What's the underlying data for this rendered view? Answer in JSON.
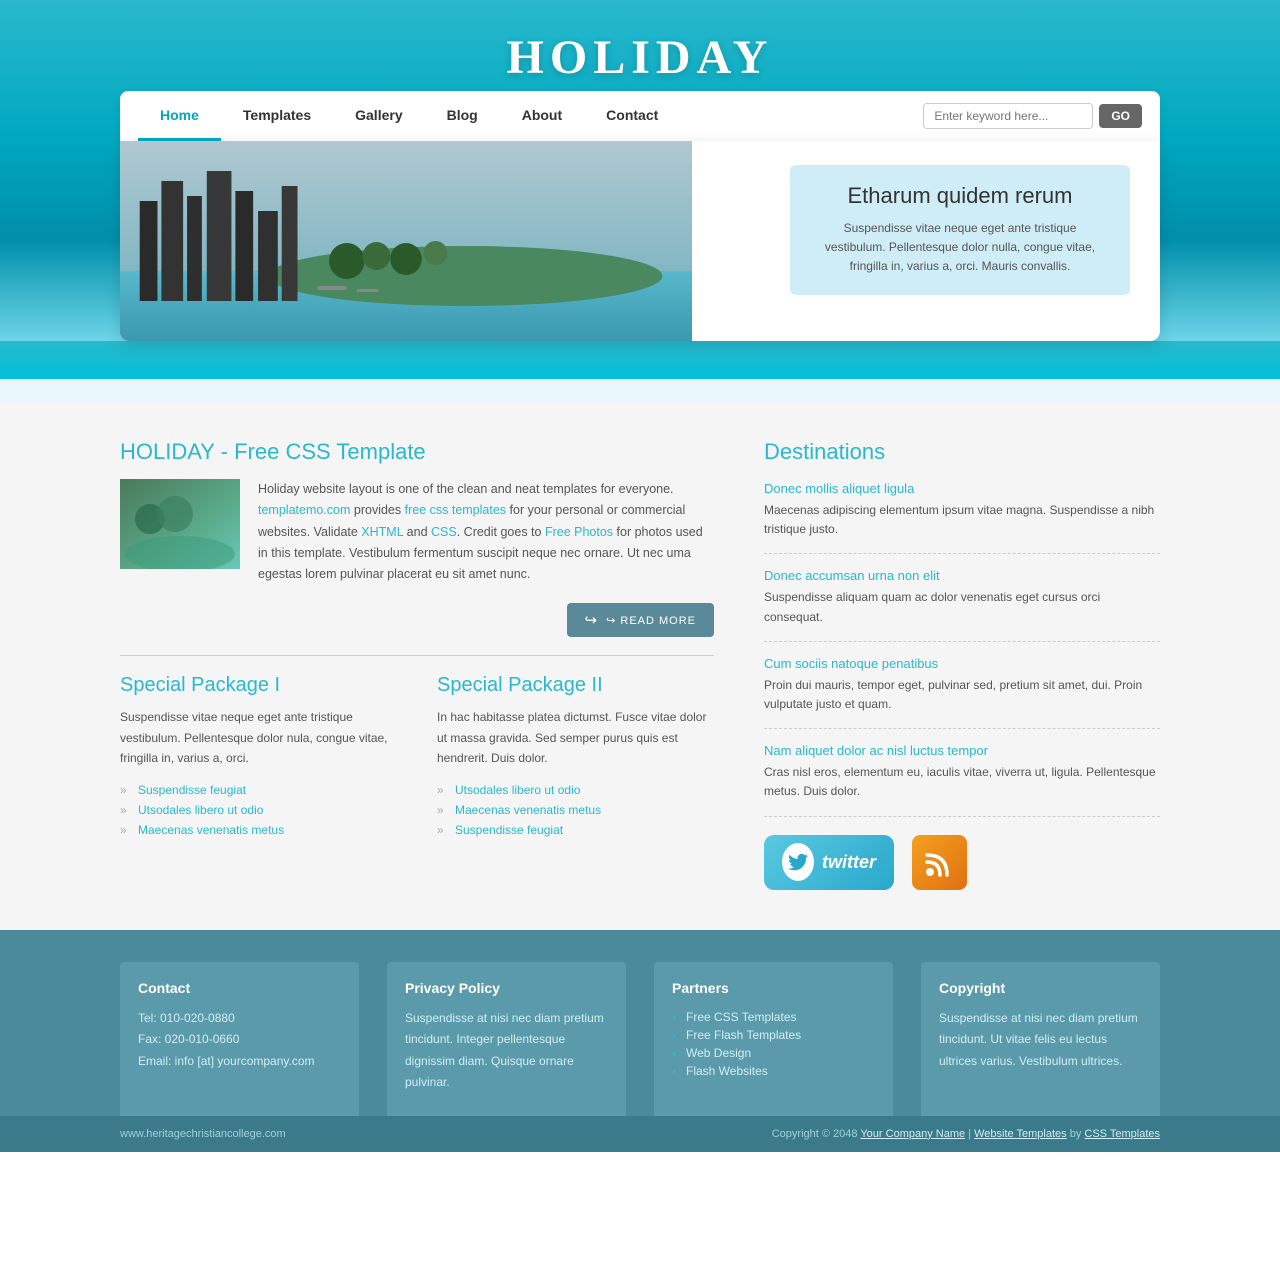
{
  "site": {
    "title": "HOLIDAY",
    "title_reflection": "HOLIDAY"
  },
  "nav": {
    "links": [
      {
        "label": "Home",
        "active": true
      },
      {
        "label": "Templates",
        "active": false
      },
      {
        "label": "Gallery",
        "active": false
      },
      {
        "label": "Blog",
        "active": false
      },
      {
        "label": "About",
        "active": false
      },
      {
        "label": "Contact",
        "active": false
      }
    ],
    "search_placeholder": "Enter keyword here...",
    "search_button": "GO"
  },
  "hero": {
    "heading": "Etharum quidem rerum",
    "text": "Suspendisse vitae neque eget ante tristique vestibulum. Pellentesque dolor nulla, congue vitae, fringilla in, varius a, orci. Mauris convallis."
  },
  "main": {
    "section_title": "HOLIDAY - Free CSS Template",
    "intro_text_1": "Holiday website layout is one of the clean and neat templates for everyone.",
    "intro_link_1": "templatemo.com",
    "intro_text_2": " provides ",
    "intro_link_2": "free css templates",
    "intro_text_3": " for your personal or commercial websites. Validate ",
    "intro_link_3": "XHTML",
    "intro_text_4": " and ",
    "intro_link_4": "CSS",
    "intro_text_5": ". Credit goes to ",
    "intro_link_5": "Free Photos",
    "intro_text_6": " for photos used in this template. Vestibulum fermentum suscipit neque nec ornare. Ut nec uma egestas lorem pulvinar placerat eu sit amet nunc.",
    "read_more": "READ MORE"
  },
  "packages": [
    {
      "title": "Special Package I",
      "text": "Suspendisse vitae neque eget ante tristique vestibulum. Pellentesque dolor nula, congue vitae, fringilla in, varius a, orci.",
      "items": [
        "Suspendisse feugiat",
        "Utsodales libero ut odio",
        "Maecenas venenatis metus"
      ]
    },
    {
      "title": "Special Package II",
      "text": "In hac habitasse platea dictumst. Fusce vitae dolor ut massa gravida. Sed semper purus quis est hendrerit. Duis dolor.",
      "items": [
        "Utsodales libero ut odio",
        "Maecenas venenatis metus",
        "Suspendisse feugiat"
      ]
    }
  ],
  "destinations": {
    "title": "Destinations",
    "items": [
      {
        "title": "Donec mollis aliquet ligula",
        "text": "Maecenas adipiscing elementum ipsum vitae magna. Suspendisse a nibh tristique justo."
      },
      {
        "title": "Donec accumsan urna non elit",
        "text": "Suspendisse aliquam quam ac dolor venenatis eget cursus orci consequat."
      },
      {
        "title": "Cum sociis natoque penatibus",
        "text": "Proin dui mauris, tempor eget, pulvinar sed, pretium sit amet, dui. Proin vulputate justo et quam."
      },
      {
        "title": "Nam aliquet dolor ac nisl luctus tempor",
        "text": "Cras nisl eros, elementum eu, iaculis vitae, viverra ut, ligula. Pellentesque metus. Duis dolor."
      }
    ]
  },
  "footer": {
    "columns": [
      {
        "heading": "Contact",
        "lines": [
          "Tel: 010-020-0880",
          "Fax: 020-010-0660",
          "Email: info [at] yourcompany.com"
        ]
      },
      {
        "heading": "Privacy Policy",
        "text": "Suspendisse at nisi nec diam pretium tincidunt. Integer pellentesque dignissim diam. Quisque ornare pulvinar."
      },
      {
        "heading": "Partners",
        "links": [
          "Free CSS Templates",
          "Free Flash Templates",
          "Web Design",
          "Flash Websites"
        ]
      },
      {
        "heading": "Copyright",
        "text": "Suspendisse at nisi nec diam pretium tincidunt. Ut vitae felis eu lectus ultrices varius. Vestibulum ultrices."
      }
    ],
    "bottom_left": "www.heritagechristiancollege.com",
    "copyright": "Copyright © 2048",
    "company_link": "Your Company Name",
    "separator": "|",
    "website_link": "Website Templates",
    "by": "by",
    "css_link": "CSS Templates"
  }
}
